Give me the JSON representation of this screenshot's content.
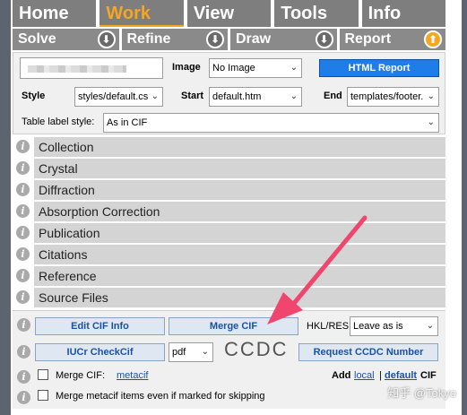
{
  "nav": {
    "tabs": [
      "Home",
      "Work",
      "View",
      "Tools",
      "Info"
    ],
    "active": "Work"
  },
  "subnav": {
    "items": [
      "Solve",
      "Refine",
      "Draw",
      "Report"
    ]
  },
  "settings": {
    "image_label": "Image",
    "image_value": "No Image",
    "html_report": "HTML Report",
    "style_label": "Style",
    "style_value": "styles/default.cs",
    "start_label": "Start",
    "start_value": "default.htm",
    "end_label": "End",
    "end_value": "templates/footer.",
    "table_label_style": "Table label style:",
    "table_label_value": "As in CIF"
  },
  "sections": [
    "Collection",
    "Crystal",
    "Diffraction",
    "Absorption Correction",
    "Publication",
    "Citations",
    "Reference",
    "Source Files"
  ],
  "bottom": {
    "edit_cif_info": "Edit CIF Info",
    "merge_cif": "Merge CIF",
    "hkl_res_label": "HKL/RES",
    "hkl_res_value": "Leave as is",
    "iucr_checkcif": "IUCr CheckCif",
    "format_value": "pdf",
    "ccdc_logo": "CCDC",
    "request_ccdc": "Request CCDC Number",
    "merge_cif_check_label": "Merge CIF:",
    "metacif_link": "metacif",
    "add_label": "Add",
    "local_link": "local",
    "separator": "|",
    "default_link": "default",
    "cif_label": "CIF",
    "merge_metacif_label": "Merge metacif items even if marked for skipping"
  },
  "watermark": "知乎 @Tokyo",
  "colors": {
    "accent": "#f5a623",
    "button_blue": "#1e7de8",
    "link_blue": "#1a52a6",
    "annotation_arrow": "#f0466e"
  }
}
